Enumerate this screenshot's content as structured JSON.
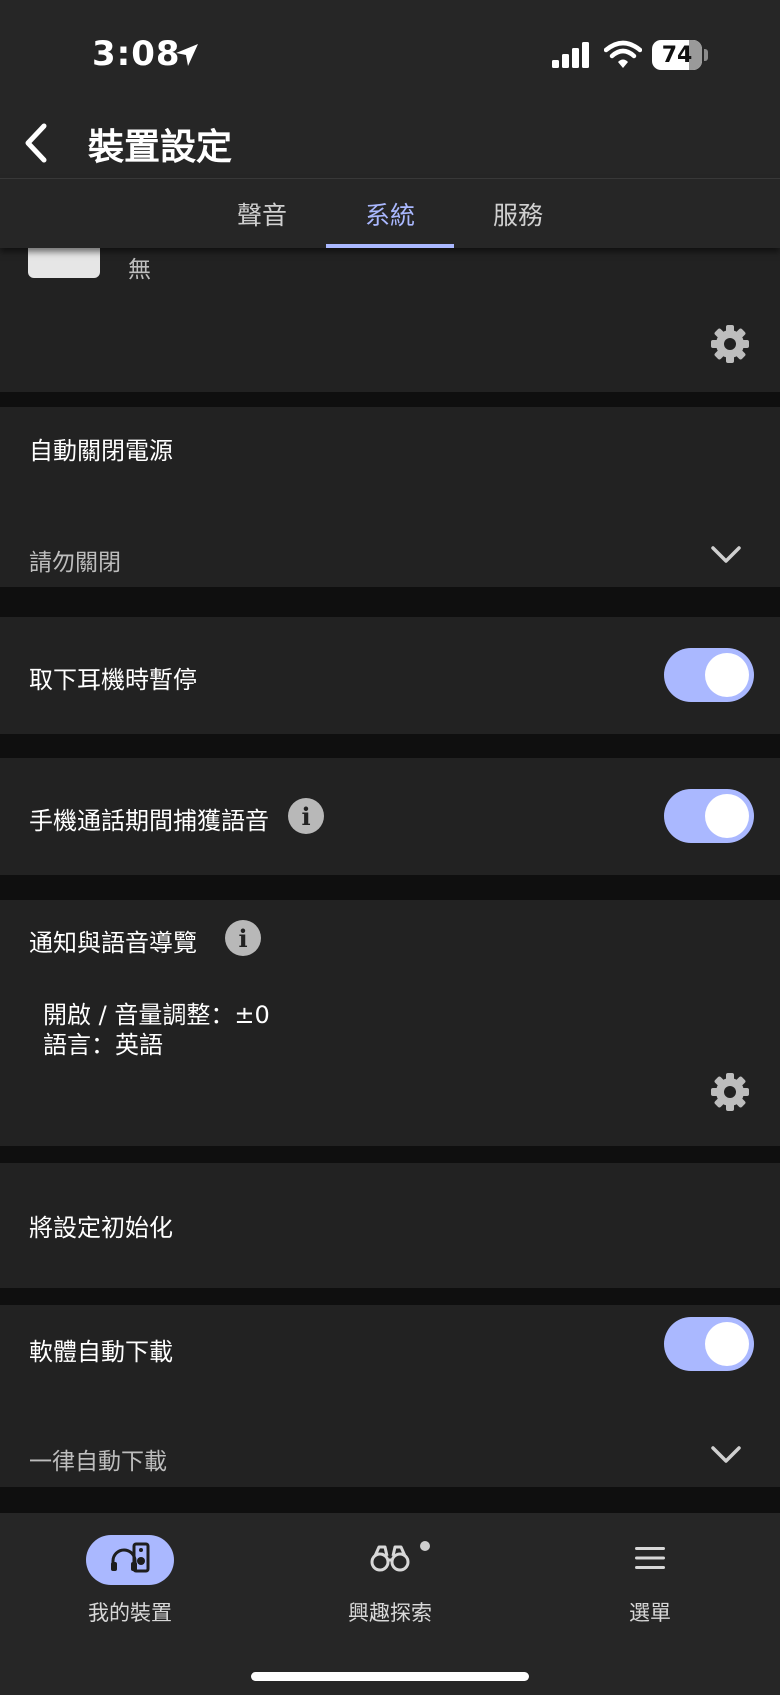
{
  "status_bar": {
    "time": "3:08",
    "battery": "74",
    "battery_level": 0.74
  },
  "header": {
    "title": "裝置設定"
  },
  "tabs": [
    {
      "label": "聲音",
      "active": false
    },
    {
      "label": "系統",
      "active": true
    },
    {
      "label": "服務",
      "active": false
    }
  ],
  "sections": {
    "top_partial": {
      "value": "無"
    },
    "auto_power_off": {
      "label": "自動關閉電源",
      "value": "請勿關閉"
    },
    "pause_on_remove": {
      "label": "取下耳機時暫停",
      "on": true
    },
    "capture_voice": {
      "label": "手機通話期間捕獲語音",
      "on": true
    },
    "voice_guide": {
      "label": "通知與語音導覽",
      "line1": "開啟 / 音量調整：±0",
      "line2": "語言：英語"
    },
    "reset": {
      "label": "將設定初始化"
    },
    "auto_download": {
      "label": "軟體自動下載",
      "on": true,
      "value": "一律自動下載"
    }
  },
  "bottom_nav": [
    {
      "label": "我的裝置",
      "icon": "headphone-speaker-icon",
      "active": true
    },
    {
      "label": "興趣探索",
      "icon": "binoculars-icon",
      "active": false,
      "badge_dot": true
    },
    {
      "label": "選單",
      "icon": "menu-icon",
      "active": false
    }
  ],
  "colors": {
    "accent": "#aab8ff",
    "card": "#222222",
    "bar": "#262626",
    "divider": "#0f0f0f"
  }
}
